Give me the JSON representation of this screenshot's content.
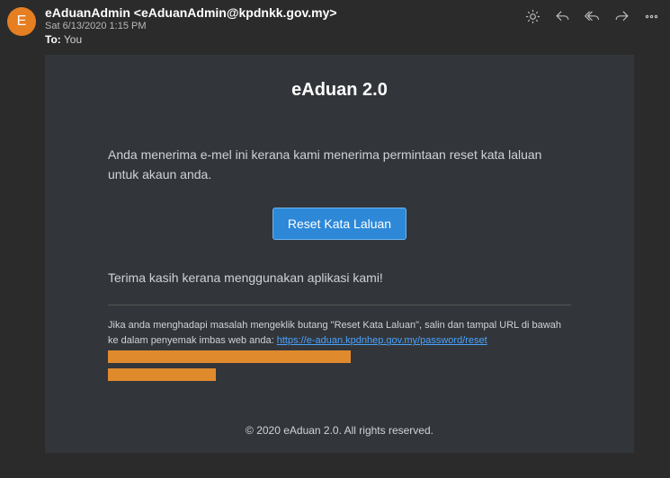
{
  "header": {
    "avatar_initial": "E",
    "from": "eAduanAdmin <eAduanAdmin@kpdnkk.gov.my>",
    "date": "Sat 6/13/2020 1:15 PM",
    "to_label": "To:",
    "to_value": "You"
  },
  "email": {
    "title": "eAduan 2.0",
    "intro": "Anda menerima e-mel ini kerana kami menerima permintaan reset kata laluan untuk akaun anda.",
    "reset_button": "Reset Kata Laluan",
    "thanks": "Terima kasih kerana menggunakan aplikasi kami!",
    "trouble_prefix": "Jika anda menghadapi masalah mengeklik butang \"Reset Kata Laluan\", salin dan tampal URL di bawah ke dalam penyemak imbas web anda: ",
    "reset_url": "https://e-aduan.kpdnhep.gov.my/password/reset"
  },
  "footer": {
    "copyright": "© 2020 eAduan 2.0. All rights reserved."
  }
}
